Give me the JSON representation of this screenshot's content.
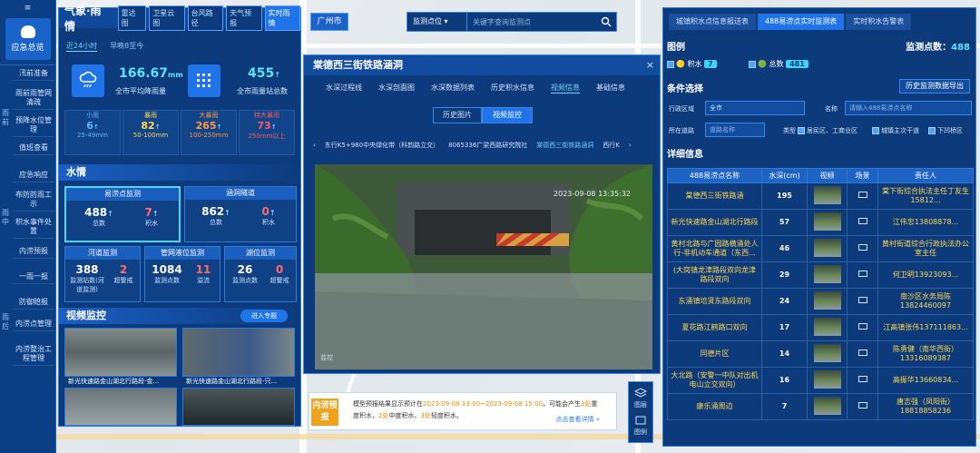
{
  "nav": {
    "menu_icon": "≡",
    "home_label": "应急总览",
    "groups": [
      "雨前",
      "雨中",
      "雨后"
    ],
    "items": [
      "汛前准备",
      "雨前雨管网清疏",
      "预降水位管理",
      "值班查看",
      "应急响应",
      "布防防雨工示",
      "积水事件处置",
      "内涝预报",
      "一雨一报",
      "防御赔报",
      "内涝点管理",
      "内涝整治工程管理"
    ]
  },
  "left": {
    "title": "气象·雨情",
    "tabs": [
      "雷达图",
      "卫星云图",
      "台风路径",
      "天气预报",
      "实时雨情"
    ],
    "subtabs": [
      "近24小时",
      "早晚8至今"
    ],
    "avg_rain_value": "166.67",
    "avg_rain_unit": "mm",
    "avg_rain_label": "全市平均降雨量",
    "stations_value": "455",
    "stations_label": "全市雨量站总数",
    "levels": [
      {
        "name": "小雨",
        "value": "6",
        "range": "25-49mm",
        "color": "#5fb8ff"
      },
      {
        "name": "暴雨",
        "value": "82",
        "range": "50-100mm",
        "color": "#ffd84d"
      },
      {
        "name": "大暴雨",
        "value": "265",
        "range": "100-250mm",
        "color": "#ff9a3c"
      },
      {
        "name": "特大暴雨",
        "value": "73",
        "range": "250mm以上",
        "color": "#ff5a5a"
      }
    ],
    "water_title": "水情",
    "monitors": [
      {
        "title": "易涝点监测",
        "a": "488",
        "al": "总数",
        "b": "7",
        "bl": "积水"
      },
      {
        "title": "涵洞隧道",
        "a": "862",
        "al": "总数",
        "b": "0",
        "bl": "积水"
      },
      {
        "title": "河道监测",
        "a": "388",
        "al": "监测站数(河道监测)",
        "b": "2",
        "bl": "超警戒"
      },
      {
        "title": "管网液位监测",
        "a": "1084",
        "al": "监测点数",
        "b": "11",
        "bl": "溢流"
      },
      {
        "title": "湖位监测",
        "a": "26",
        "al": "监测点数",
        "b": "0",
        "bl": "超警戒"
      }
    ],
    "video_title": "视频监控",
    "video_button": "进入专题",
    "videos": [
      "新光快速路金山湖北行路段-金...",
      "新光快速路金山湖北行路段-只..."
    ]
  },
  "search": {
    "city": "广州市",
    "select": "监测点位",
    "placeholder": "关键字查询监测点"
  },
  "dialog": {
    "title": "棠德西三街铁路涵洞",
    "close": "×",
    "tabs": [
      "水深过程线",
      "水深剖面图",
      "水深数据列表",
      "历史积水信息",
      "视频信息",
      "基础信息"
    ],
    "pill_history": "历史图片",
    "pill_live": "视频监控",
    "strip": [
      "‹",
      "东行K5+980中央绿化带（科韵路立交）",
      "8065336广梁西路研究院社",
      "棠德西三街铁路涵洞",
      "西行K",
      "›"
    ],
    "timestamp": "2023-09-08 13:35:32",
    "cam_label": "监控"
  },
  "alert": {
    "badge": "内涝预报",
    "text_pre": "模型预报结果显示预计在",
    "time_range": "2023-09-08 13:00~2023-09-08 15:00",
    "text_mid": "，可能会产生",
    "n_heavy": "3处",
    "t_heavy": "重度积水，",
    "n_mid": "2处",
    "t_mid": "中度积水、",
    "n_light": "3处",
    "t_light": "轻度积水。",
    "link": "点击查看详情 »"
  },
  "tools": {
    "layers": "图层",
    "legend": "图例"
  },
  "right": {
    "tabs": [
      "城镇积水点信息报送表",
      "488易涝点实时监测表",
      "实时积水告警表"
    ],
    "legend_title": "图例",
    "count_label": "监测点数：",
    "count_value": "488",
    "legend_items": [
      {
        "label": "积水",
        "value": "7"
      },
      {
        "label": "总数",
        "value": "481"
      }
    ],
    "filter_title": "条件选择",
    "export_btn": "历史监测数据导出",
    "region_label": "行政区域",
    "region_value": "全市",
    "name_label": "名称",
    "name_placeholder": "请输入488易涝点名称",
    "street_label": "所在道路",
    "street_placeholder": "道路名称",
    "type_label": "类型",
    "types": [
      "居民区、工商业区",
      "城镇主次干道",
      "下凹桥区"
    ],
    "detail_title": "详细信息",
    "columns": [
      "488易涝点名称",
      "水深(cm)",
      "视频",
      "场景",
      "责任人"
    ],
    "rows": [
      {
        "name": "棠德西三街铁路涵",
        "depth": "195",
        "person": "棠下街综合执法主任丁友生15812..."
      },
      {
        "name": "新光快速路金山湖北行路段",
        "depth": "57",
        "person": "江伟忠13808878..."
      },
      {
        "name": "黄村北路与广园路横涌处人行-非机动车通道（东西...",
        "depth": "46",
        "person": "黄村街道综合行政执法办公室主任"
      },
      {
        "name": "(大岗镇龙津路段双向龙津路段双向",
        "depth": "29",
        "person": "何卫明13923093..."
      },
      {
        "name": "东涌镇培贤东路段双向",
        "depth": "24",
        "person": "南沙区水务局陈13824460097"
      },
      {
        "name": "夏花路江鹤路口双向",
        "depth": "17",
        "person": "江高镇张伟137111863..."
      },
      {
        "name": "同德片区",
        "depth": "14",
        "person": "陈勇健（南华西街）13316089387"
      },
      {
        "name": "大北路（安警一中队对出机电山立交双向）",
        "depth": "16",
        "person": "高振华13660834..."
      },
      {
        "name": "康乐涌周边",
        "depth": "7",
        "person": "唐志强（凤阳街）18818858236"
      }
    ]
  },
  "colors": {
    "panel": "#0d3a7a",
    "accent": "#1e74e8",
    "cyan": "#5ee3ff"
  }
}
